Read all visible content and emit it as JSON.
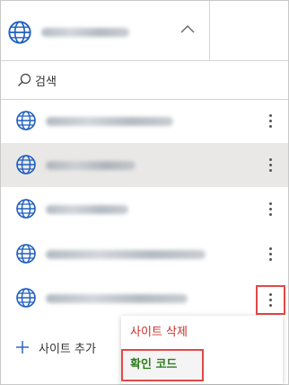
{
  "header": {
    "site_name": "",
    "expand_icon": "chevron-down-icon"
  },
  "search": {
    "label": "검색",
    "icon": "search-icon"
  },
  "sites": [
    {
      "name": "",
      "selected": false
    },
    {
      "name": "",
      "selected": true
    },
    {
      "name": "",
      "selected": false
    },
    {
      "name": "",
      "selected": false
    },
    {
      "name": "",
      "selected": false
    }
  ],
  "add_site": {
    "label": "사이트 추가",
    "icon": "plus-icon"
  },
  "context_menu": {
    "delete_label": "사이트 삭제",
    "verify_label": "확인 코드"
  },
  "colors": {
    "selected_row": "#eae8e6",
    "highlight_border": "#e24848",
    "delete_text": "#c9302c",
    "verify_text": "#2f7d1f",
    "globe": "#1f5fbf"
  }
}
